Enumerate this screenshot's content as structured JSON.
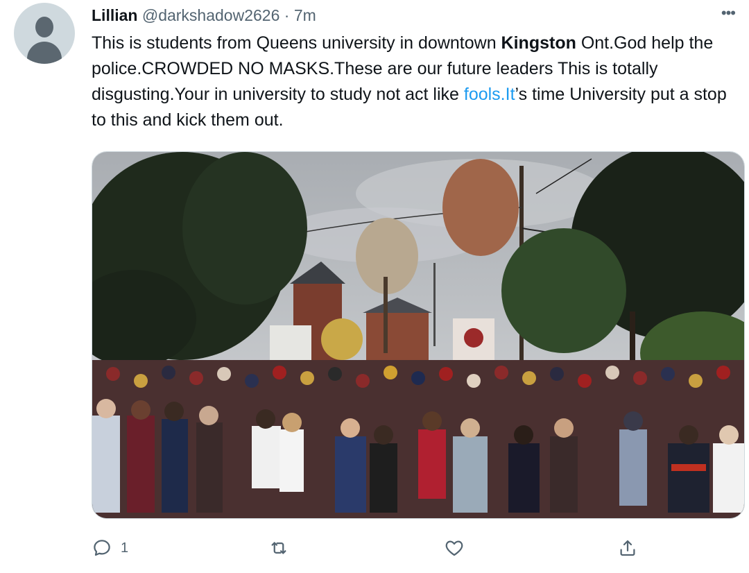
{
  "tweet": {
    "author_name": "Lillian",
    "handle": "@darkshadow2626",
    "separator": "·",
    "time": "7m",
    "more_icon": "more-horizontal-icon",
    "text_parts": {
      "p1": "This is students from Queens university in downtown ",
      "bold1": "Kingston",
      "p2": " Ont.God help the police.CROWDED NO MASKS.These are our future leaders This is totally disgusting.Your in university to study not act like ",
      "link1": "fools.It",
      "p3": "’s time University put a stop to this and kick them out."
    },
    "media": {
      "kind": "photo",
      "subject": "crowd-on-street"
    },
    "actions": {
      "reply": {
        "icon": "reply-icon",
        "count": "1"
      },
      "retweet": {
        "icon": "retweet-icon",
        "count": ""
      },
      "like": {
        "icon": "heart-icon",
        "count": ""
      },
      "share": {
        "icon": "share-icon",
        "count": ""
      }
    }
  },
  "colors": {
    "link": "#1d9bf0",
    "secondary_text": "#536471",
    "primary_text": "#0f1419"
  }
}
